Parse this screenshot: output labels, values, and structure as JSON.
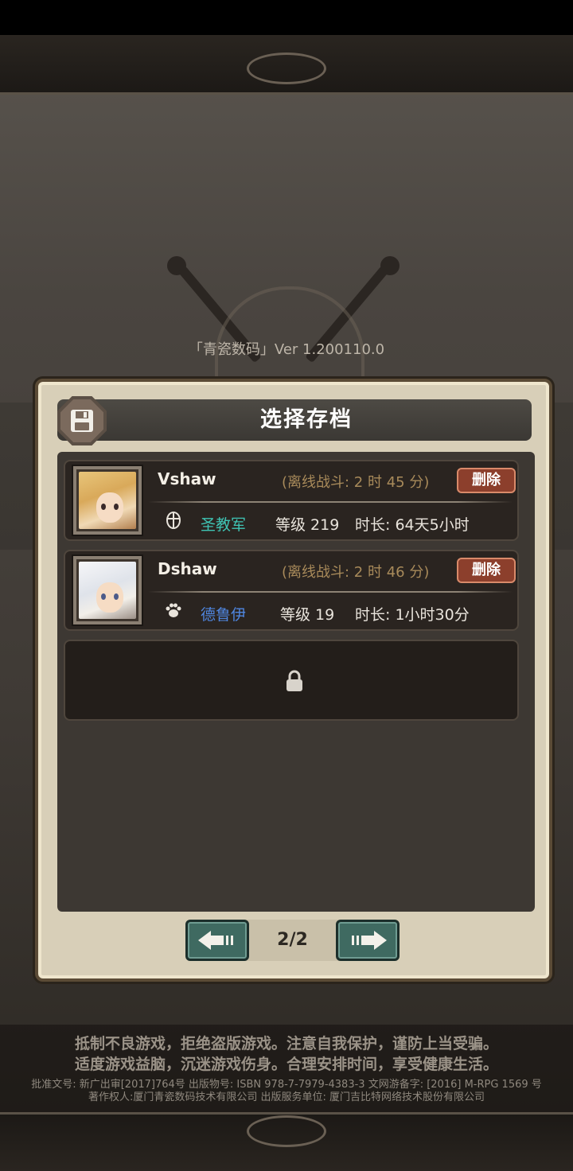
{
  "header": {
    "version_text": "「青瓷数码」Ver 1.200110.0"
  },
  "dialog": {
    "title": "选择存档",
    "badge_icon": "floppy-disk-icon"
  },
  "slots": [
    {
      "name": "Vshaw",
      "offline_battle": "(离线战斗: 2 时 45 分)",
      "delete_label": "删除",
      "class_icon": "cross-shield-icon",
      "class_name": "圣教军",
      "class_color": "#3fc4b4",
      "level": "等级 219",
      "playtime": "时长: 64天5小时"
    },
    {
      "name": "Dshaw",
      "offline_battle": "(离线战斗: 2 时 46 分)",
      "delete_label": "删除",
      "class_icon": "paw-icon",
      "class_name": "德鲁伊",
      "class_color": "#4f86e0",
      "level": "等级 19",
      "playtime": "时长: 1小时30分"
    },
    {
      "locked": true,
      "icon": "lock-icon"
    }
  ],
  "pager": {
    "page_indicator": "2/2",
    "prev_icon": "arrow-left-icon",
    "next_icon": "arrow-right-icon"
  },
  "footer": {
    "notice_line1": "抵制不良游戏，拒绝盗版游戏。注意自我保护，谨防上当受骗。",
    "notice_line2": "适度游戏益脑，沉迷游戏伤身。合理安排时间，享受健康生活。",
    "legal_line1": "批准文号: 新广出审[2017]764号 出版物号: ISBN 978-7-7979-4383-3 文网游备字: [2016] M-RPG 1569 号",
    "legal_line2": "著作权人:厦门青瓷数码技术有限公司 出版服务单位: 厦门吉比特网络技术股份有限公司"
  }
}
